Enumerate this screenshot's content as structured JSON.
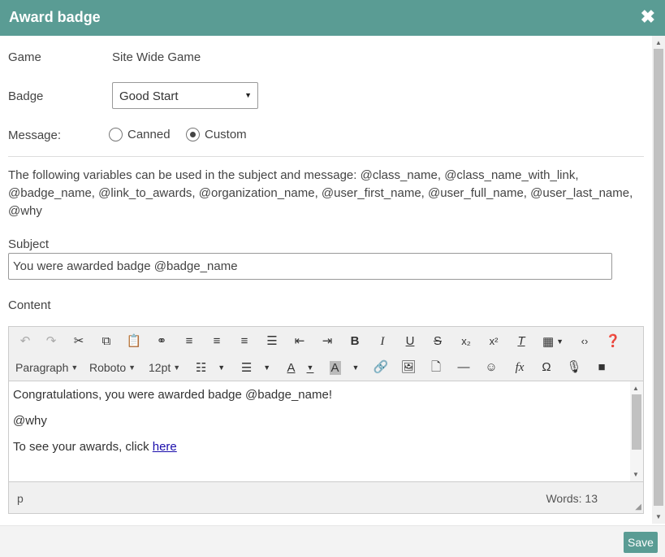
{
  "dialog": {
    "title": "Award badge"
  },
  "form": {
    "game_label": "Game",
    "game_value": "Site Wide Game",
    "badge_label": "Badge",
    "badge_selected": "Good Start",
    "message_label": "Message:",
    "message_options": [
      {
        "label": "Canned",
        "checked": false
      },
      {
        "label": "Custom",
        "checked": true
      }
    ],
    "variables_text": "The following variables can be used in the subject and message: @class_name, @class_name_with_link, @badge_name, @link_to_awards, @organization_name, @user_first_name, @user_full_name, @user_last_name, @why",
    "subject_label": "Subject",
    "subject_value": "You were awarded badge @badge_name",
    "content_label": "Content"
  },
  "editor": {
    "toolbar_menus": {
      "format": "Paragraph",
      "font": "Roboto",
      "size": "12pt"
    },
    "content_lines": [
      "Congratulations, you were awarded badge @badge_name!",
      "@why"
    ],
    "link_line_prefix": "To see your awards, click ",
    "link_text": "here",
    "status_path": "p",
    "word_count": "Words: 13"
  },
  "footer": {
    "save_label": "Save"
  },
  "colors": {
    "header": "#5a9c94",
    "save_button": "#5a9c94"
  }
}
